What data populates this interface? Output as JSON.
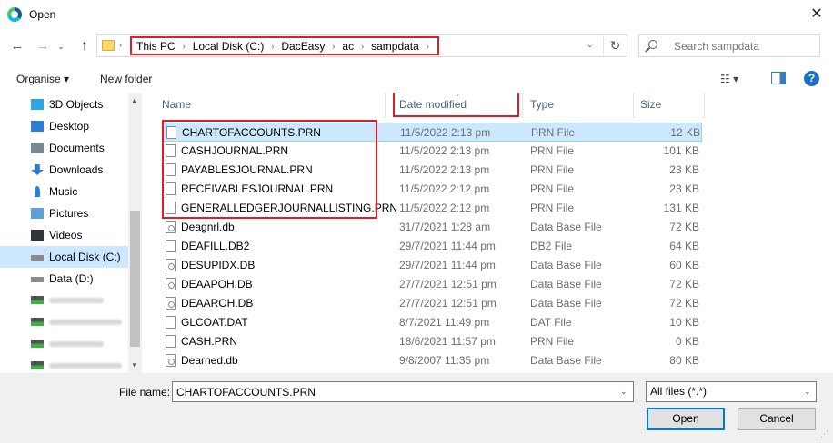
{
  "window": {
    "title": "Open",
    "close_glyph": "✕"
  },
  "nav": {
    "back_glyph": "←",
    "forward_glyph": "→",
    "history_glyph": "⌄",
    "up_glyph": "↑",
    "refresh_glyph": "↻",
    "breadcrumbs": [
      "This PC",
      "Local Disk (C:)",
      "DacEasy",
      "ac",
      "sampdata"
    ],
    "search_placeholder": "Search sampdata"
  },
  "toolbar": {
    "organise": "Organise ▾",
    "new_folder": "New folder",
    "view_glyph": "☷ ▾",
    "help_glyph": "?"
  },
  "sidebar": {
    "items": [
      {
        "label": "3D Objects",
        "icon": "cube-icon",
        "color": "#2da7e0"
      },
      {
        "label": "Desktop",
        "icon": "desktop-icon",
        "color": "#2d7fd6"
      },
      {
        "label": "Documents",
        "icon": "documents-icon",
        "color": "#7a8794"
      },
      {
        "label": "Downloads",
        "icon": "download-icon",
        "color": "#2d7fd6"
      },
      {
        "label": "Music",
        "icon": "music-icon",
        "color": "#2d7fd6"
      },
      {
        "label": "Pictures",
        "icon": "pictures-icon",
        "color": "#5fa0d8"
      },
      {
        "label": "Videos",
        "icon": "videos-icon",
        "color": "#333333"
      },
      {
        "label": "Local Disk (C:)",
        "icon": "drive-icon",
        "color": "#8a8a8a",
        "selected": true
      },
      {
        "label": "Data (D:)",
        "icon": "drive-icon",
        "color": "#8a8a8a"
      }
    ],
    "network_drives": 4
  },
  "columns": {
    "name": "Name",
    "date": "Date modified",
    "type": "Type",
    "size": "Size"
  },
  "files": [
    {
      "name": "CHARTOFACCOUNTS.PRN",
      "date": "11/5/2022 2:13 pm",
      "type": "PRN File",
      "size": "12 KB",
      "selected": true,
      "kind": "file"
    },
    {
      "name": "CASHJOURNAL.PRN",
      "date": "11/5/2022 2:13 pm",
      "type": "PRN File",
      "size": "101 KB",
      "kind": "file"
    },
    {
      "name": "PAYABLESJOURNAL.PRN",
      "date": "11/5/2022 2:13 pm",
      "type": "PRN File",
      "size": "23 KB",
      "kind": "file"
    },
    {
      "name": "RECEIVABLESJOURNAL.PRN",
      "date": "11/5/2022 2:12 pm",
      "type": "PRN File",
      "size": "23 KB",
      "kind": "file"
    },
    {
      "name": "GENERALLEDGERJOURNALLISTING.PRN",
      "date": "11/5/2022 2:12 pm",
      "type": "PRN File",
      "size": "131 KB",
      "kind": "file"
    },
    {
      "name": "Deagnrl.db",
      "date": "31/7/2021 1:28 am",
      "type": "Data Base File",
      "size": "72 KB",
      "kind": "db"
    },
    {
      "name": "DEAFILL.DB2",
      "date": "29/7/2021 11:44 pm",
      "type": "DB2 File",
      "size": "64 KB",
      "kind": "file"
    },
    {
      "name": "DESUPIDX.DB",
      "date": "29/7/2021 11:44 pm",
      "type": "Data Base File",
      "size": "60 KB",
      "kind": "db"
    },
    {
      "name": "DEAAPOH.DB",
      "date": "27/7/2021 12:51 pm",
      "type": "Data Base File",
      "size": "72 KB",
      "kind": "db"
    },
    {
      "name": "DEAAROH.DB",
      "date": "27/7/2021 12:51 pm",
      "type": "Data Base File",
      "size": "72 KB",
      "kind": "db"
    },
    {
      "name": "GLCOAT.DAT",
      "date": "8/7/2021 11:49 pm",
      "type": "DAT File",
      "size": "10 KB",
      "kind": "file"
    },
    {
      "name": "CASH.PRN",
      "date": "18/6/2021 11:57 pm",
      "type": "PRN File",
      "size": "0 KB",
      "kind": "file"
    },
    {
      "name": "Dearhed.db",
      "date": "9/8/2007 11:35 pm",
      "type": "Data Base File",
      "size": "80 KB",
      "kind": "db"
    }
  ],
  "bottom": {
    "filename_label": "File name:",
    "filename_value": "CHARTOFACCOUNTS.PRN",
    "filetype_value": "All files (*.*)",
    "open_label": "Open",
    "cancel_label": "Cancel"
  },
  "colors": {
    "highlight": "#e01c24",
    "selection": "#cce8ff",
    "accent": "#0078d7"
  }
}
